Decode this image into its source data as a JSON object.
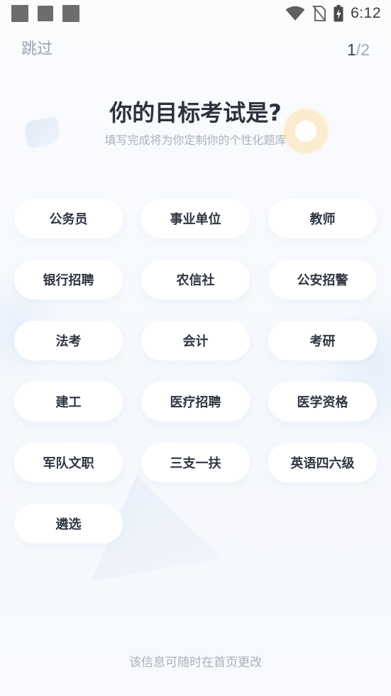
{
  "status_bar": {
    "time": "6:12",
    "icons": [
      "notification-square-icon",
      "notification-square-icon",
      "notification-square-icon",
      "wifi-icon",
      "no-sim-icon",
      "battery-charging-icon"
    ]
  },
  "nav": {
    "skip_label": "跳过",
    "page_current": "1",
    "page_separator": "/",
    "page_total": "2"
  },
  "heading": {
    "title": "你的目标考试是?",
    "subtitle": "填写完成将为你定制你的个性化题库"
  },
  "options": [
    {
      "label": "公务员"
    },
    {
      "label": "事业单位"
    },
    {
      "label": "教师"
    },
    {
      "label": "银行招聘"
    },
    {
      "label": "农信社"
    },
    {
      "label": "公安招警"
    },
    {
      "label": "法考"
    },
    {
      "label": "会计"
    },
    {
      "label": "考研"
    },
    {
      "label": "建工"
    },
    {
      "label": "医疗招聘"
    },
    {
      "label": "医学资格"
    },
    {
      "label": "军队文职"
    },
    {
      "label": "三支一扶"
    },
    {
      "label": "英语四六级"
    },
    {
      "label": "遴选"
    }
  ],
  "footer": {
    "note": "该信息可随时在首页更改"
  },
  "colors": {
    "background": "#f6f8fc",
    "chip": "#ffffff",
    "text_primary": "#2f3542",
    "text_muted": "#a9b0bd"
  }
}
